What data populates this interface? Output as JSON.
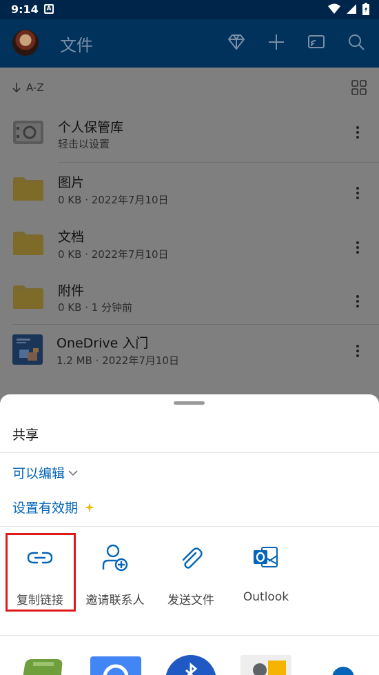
{
  "status_bar": {
    "time": "9:14",
    "notification_letter": "A"
  },
  "app_bar": {
    "title": "文件"
  },
  "list": {
    "sort_label": "A-Z",
    "items": [
      {
        "name": "个人保管库",
        "meta": "轻击以设置",
        "icon": "vault-icon"
      },
      {
        "name": "图片",
        "meta": "0 KB · 2022年7月10日",
        "icon": "folder-icon"
      },
      {
        "name": "文档",
        "meta": "0 KB · 2022年7月10日",
        "icon": "folder-icon"
      },
      {
        "name": "附件",
        "meta": "0 KB · 1 分钟前",
        "icon": "folder-icon"
      },
      {
        "name": "OneDrive 入门",
        "meta": "1.2 MB · 2022年7月10日",
        "icon": "document-thumbnail"
      }
    ]
  },
  "share_sheet": {
    "title": "共享",
    "permission": "可以编辑",
    "expiry": "设置有效期",
    "actions": [
      {
        "label": "复制链接",
        "icon": "link-icon"
      },
      {
        "label": "邀请联系人",
        "icon": "add-person-icon"
      },
      {
        "label": "发送文件",
        "icon": "paperclip-icon"
      },
      {
        "label": "Outlook",
        "icon": "outlook-icon"
      }
    ]
  },
  "colors": {
    "app_bar": "#00325c",
    "status_bar": "#00254b",
    "accent": "#0364b8",
    "highlight": "#e0191d",
    "scrim": "#7f7f7f"
  }
}
